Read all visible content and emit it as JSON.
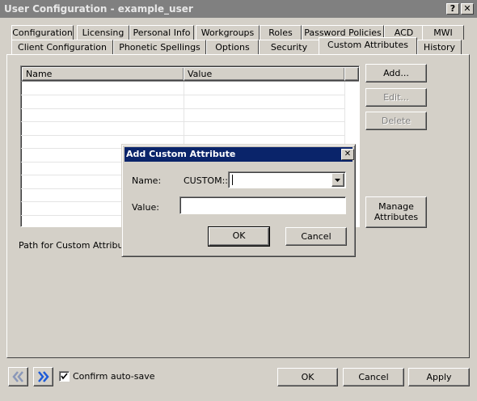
{
  "window": {
    "title": "User Configuration - example_user",
    "help_glyph": "?",
    "close_glyph": "✕"
  },
  "tabs_row1": [
    "Configuration",
    "Licensing",
    "Personal Info",
    "Workgroups",
    "Roles",
    "Password Policies",
    "ACD",
    "MWI"
  ],
  "tabs_row2": [
    "Client Configuration",
    "Phonetic Spellings",
    "Options",
    "Security",
    "Custom Attributes",
    "History"
  ],
  "active_tab": "Custom Attributes",
  "table": {
    "columns": [
      "Name",
      "Value"
    ],
    "rows": []
  },
  "side_buttons": {
    "add": "Add...",
    "edit": "Edit...",
    "delete": "Delete",
    "manage_line1": "Manage",
    "manage_line2": "Attributes"
  },
  "path_label": "Path for Custom Attributes",
  "dialog": {
    "title": "Add Custom Attribute",
    "close_glyph": "✕",
    "name_label": "Name:",
    "name_prefix": "CUSTOM::",
    "name_value": "",
    "value_label": "Value:",
    "value_value": "",
    "ok": "OK",
    "cancel": "Cancel"
  },
  "footer": {
    "confirm_autosave": "Confirm auto-save",
    "confirm_checked": true,
    "ok": "OK",
    "cancel": "Cancel",
    "apply": "Apply"
  },
  "colors": {
    "titlebar_inactive": "#808080",
    "dialog_title": "#0a246a",
    "face": "#d4d0c8",
    "nav_arrow_active": "#1c5ad8"
  },
  "icons": [
    "back-arrows-icon",
    "forward-arrows-icon",
    "help-icon",
    "close-icon",
    "dropdown-arrow-icon",
    "checkmark-icon"
  ]
}
